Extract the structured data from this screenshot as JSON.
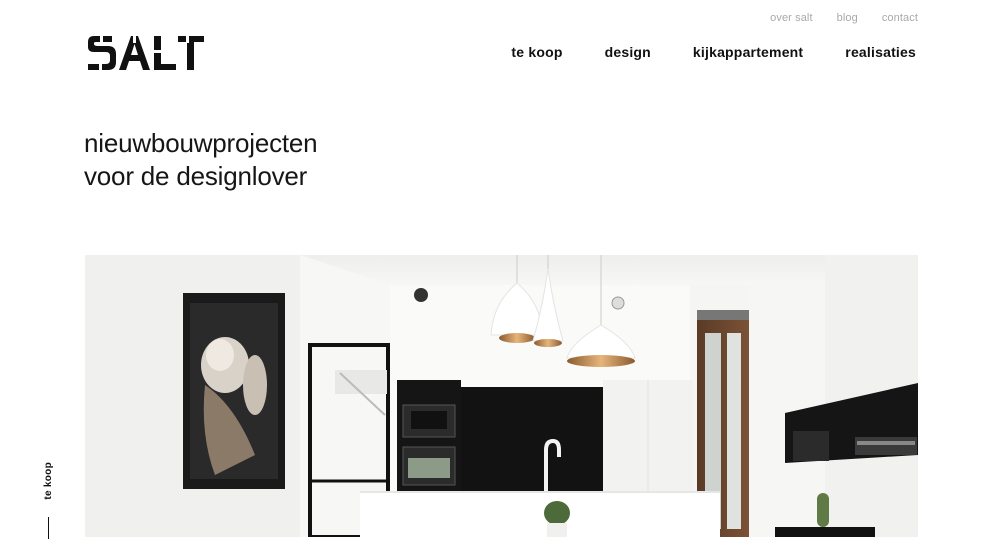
{
  "brand": {
    "logo_text": "SALT"
  },
  "utility_nav": {
    "items": [
      "over salt",
      "blog",
      "contact"
    ]
  },
  "main_nav": {
    "items": [
      "te koop",
      "design",
      "kijkappartement",
      "realisaties"
    ]
  },
  "hero": {
    "line1": "nieuwbouwprojecten",
    "line2": "voor de designlover"
  },
  "side_label": "te koop",
  "hero_image": {
    "subject": "modern white kitchen interior"
  },
  "colors": {
    "text": "#111111",
    "muted": "#a9a9a9",
    "background": "#ffffff"
  }
}
